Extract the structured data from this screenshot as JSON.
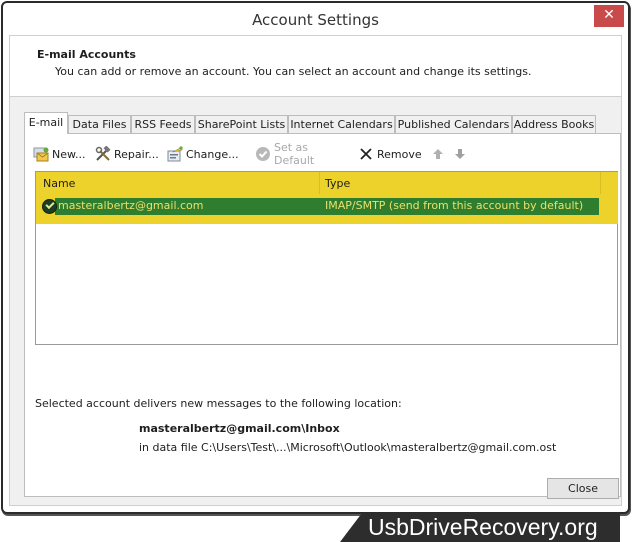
{
  "window": {
    "title": "Account Settings",
    "close_icon": "close-x-icon"
  },
  "header": {
    "title": "E-mail Accounts",
    "subtitle": "You can add or remove an account. You can select an account and change its settings."
  },
  "tabs": [
    {
      "label": "E-mail",
      "active": true
    },
    {
      "label": "Data Files",
      "active": false
    },
    {
      "label": "RSS Feeds",
      "active": false
    },
    {
      "label": "SharePoint Lists",
      "active": false
    },
    {
      "label": "Internet Calendars",
      "active": false
    },
    {
      "label": "Published Calendars",
      "active": false
    },
    {
      "label": "Address Books",
      "active": false
    }
  ],
  "toolbar": {
    "new_label": "New...",
    "repair_label": "Repair...",
    "change_label": "Change...",
    "set_default_label": "Set as Default",
    "remove_label": "Remove",
    "icons": {
      "new": "new-account-envelope-icon",
      "repair": "repair-tools-icon",
      "change": "change-settings-icon",
      "set_default": "check-circle-icon",
      "remove": "x-icon",
      "up": "arrow-up-icon",
      "down": "arrow-down-icon"
    }
  },
  "accounts_list": {
    "columns": [
      "Name",
      "Type"
    ],
    "rows": [
      {
        "name": "masteralbertz@gmail.com",
        "type": "IMAP/SMTP (send from this account by default)",
        "default": true,
        "selected": true
      }
    ],
    "highlight_color": "#ecd22a",
    "selected_row_color": "#2f7d2f"
  },
  "delivery": {
    "label": "Selected account delivers new messages to the following location:",
    "folder": "masteralbertz@gmail.com\\Inbox",
    "data_file": "in data file C:\\Users\\Test\\...\\Microsoft\\Outlook\\masteralbertz@gmail.com.ost"
  },
  "footer": {
    "close_label": "Close"
  },
  "watermark": {
    "text": "UsbDriveRecovery.org"
  }
}
